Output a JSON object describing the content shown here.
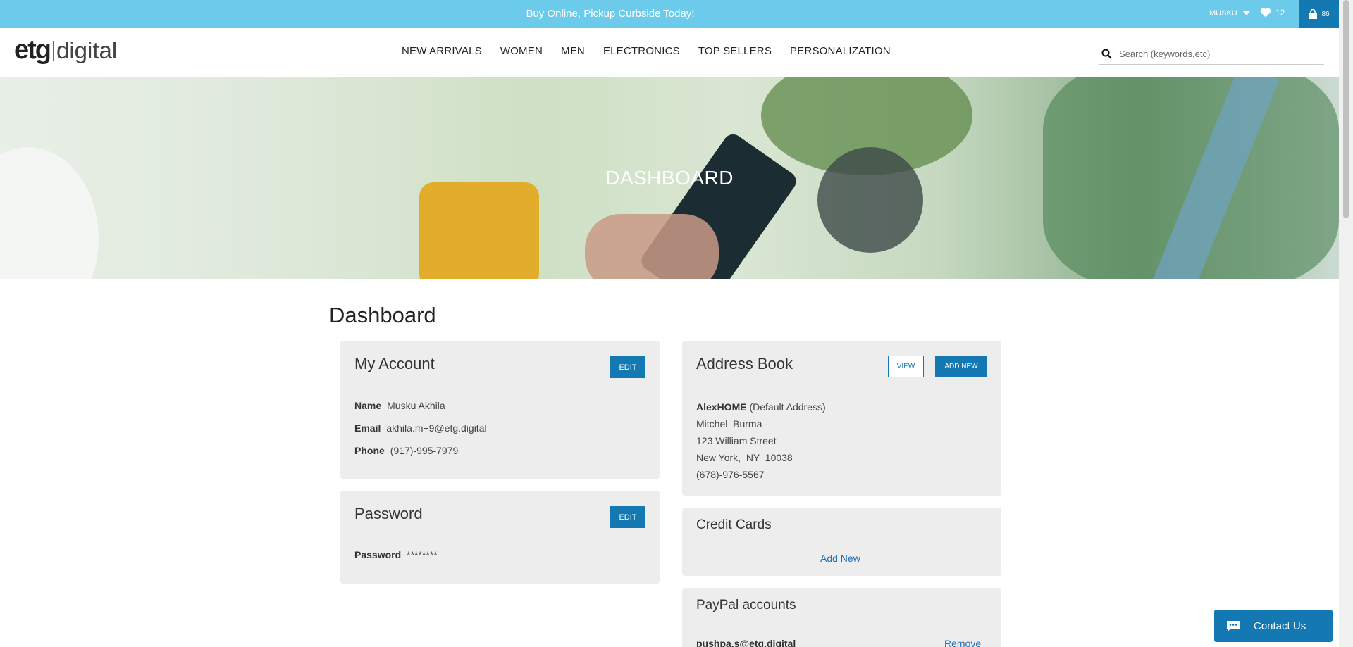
{
  "topbar": {
    "promo": "Buy Online, Pickup Curbside Today!",
    "user_name": "MUSKU",
    "wishlist_count": "12",
    "cart_count": "86"
  },
  "header": {
    "logo_left": "etg",
    "logo_right": "digital",
    "nav": [
      "NEW ARRIVALS",
      "WOMEN",
      "MEN",
      "ELECTRONICS",
      "TOP SELLERS",
      "PERSONALIZATION"
    ],
    "search_placeholder": "Search (keywords,etc)"
  },
  "hero": {
    "title": "DASHBOARD"
  },
  "page_title": "Dashboard",
  "my_account": {
    "title": "My Account",
    "edit_label": "EDIT",
    "name_label": "Name",
    "name_value": "Musku Akhila",
    "email_label": "Email",
    "email_value": "akhila.m+9@etg.digital",
    "phone_label": "Phone",
    "phone_value": "(917)-995-7979"
  },
  "password": {
    "title": "Password",
    "edit_label": "EDIT",
    "label": "Password",
    "value": "********"
  },
  "address_book": {
    "title": "Address Book",
    "view_label": "VIEW",
    "add_label": "ADD NEW",
    "nickname": "AlexHOME",
    "default_note": "(Default Address)",
    "name": "Mitchel  Burma",
    "street": "123 William Street",
    "city_line": "New York,  NY  10038",
    "phone": "(678)-976-5567"
  },
  "credit_cards": {
    "title": "Credit Cards",
    "add_label": "Add New"
  },
  "paypal": {
    "title": "PayPal accounts",
    "email": "pushpa.s@etg.digital",
    "remove_label": "Remove"
  },
  "contact": {
    "label": "Contact Us"
  },
  "colors": {
    "topbar": "#6ccbeb",
    "accent": "#1479b3",
    "card": "#ededed"
  }
}
